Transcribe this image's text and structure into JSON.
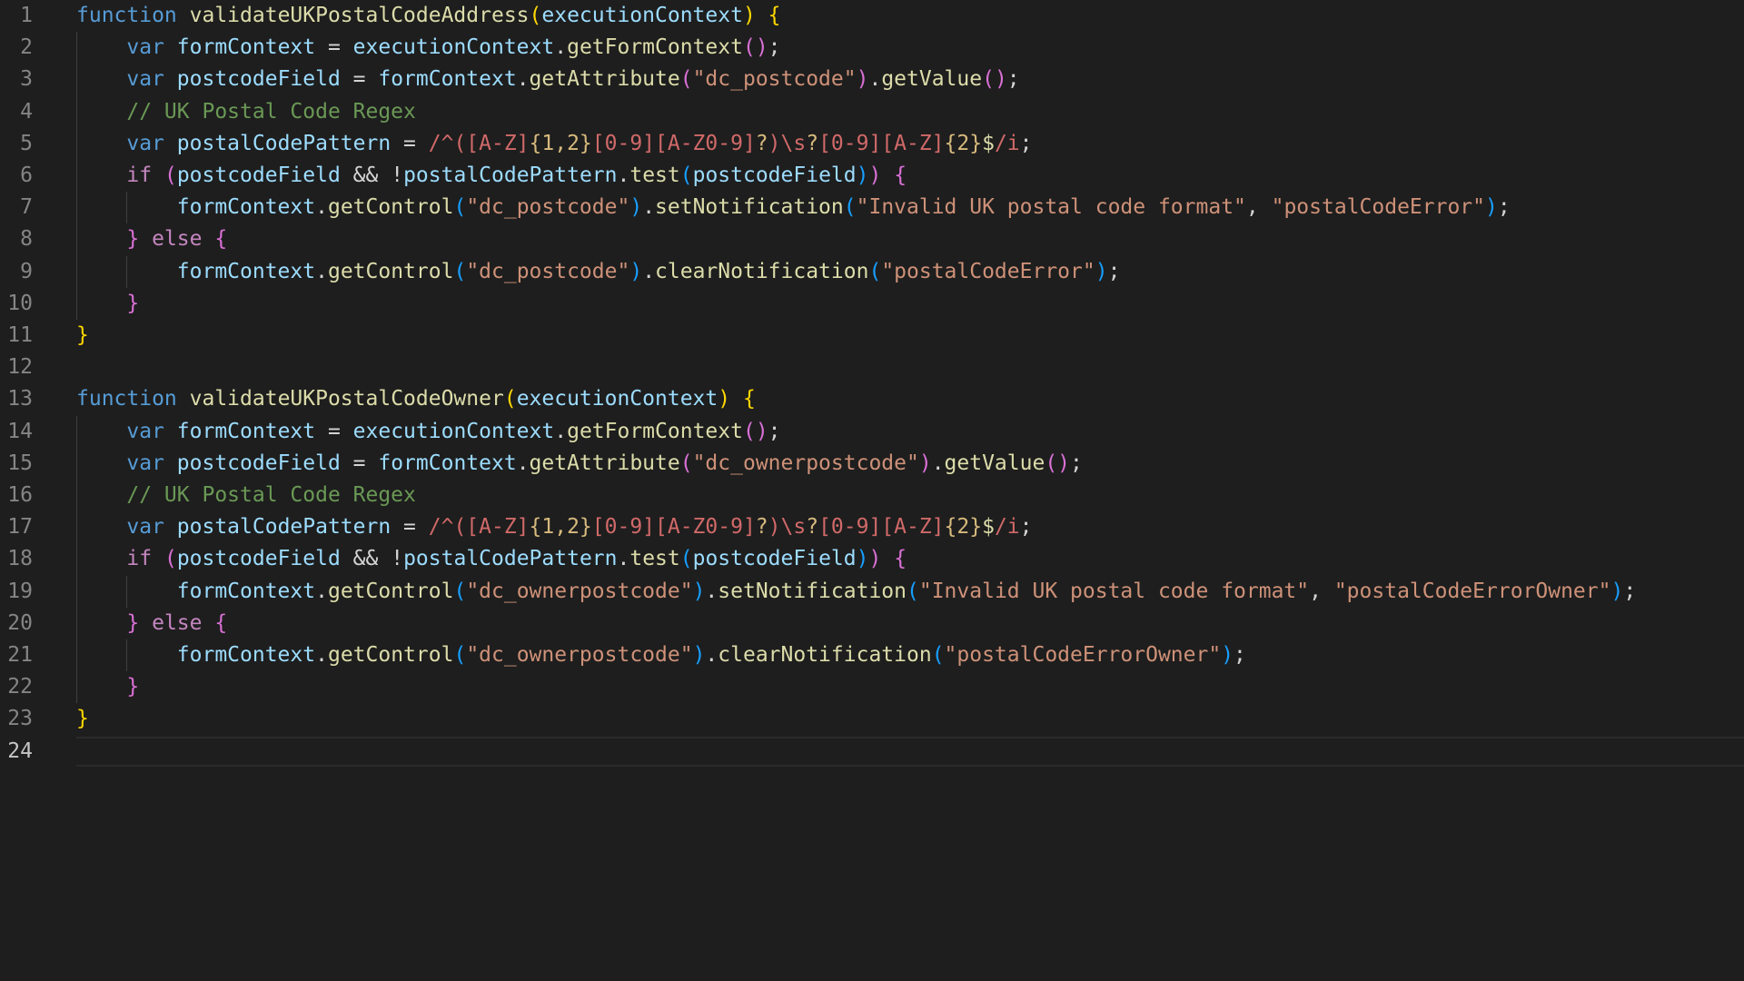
{
  "editor": {
    "language": "javascript",
    "current_line": 24,
    "colors": {
      "background": "#1e1e1e",
      "line_number": "#858585",
      "line_number_active": "#c6c6c6",
      "keyword": "#569cd6",
      "control": "#c586c0",
      "function": "#dcdcaa",
      "variable": "#9cdcfe",
      "string": "#ce9178",
      "comment": "#6a9955",
      "regex": "#d16969",
      "bracket_level_1": "#ffd700",
      "bracket_level_2": "#da70d6",
      "bracket_level_3": "#179fff"
    },
    "lines": [
      {
        "n": "1",
        "tokens": [
          [
            "kw",
            "function"
          ],
          [
            "op",
            " "
          ],
          [
            "fn",
            "validateUKPostalCodeAddress"
          ],
          [
            "b1",
            "("
          ],
          [
            "var",
            "executionContext"
          ],
          [
            "b1",
            ")"
          ],
          [
            "op",
            " "
          ],
          [
            "b1",
            "{"
          ]
        ]
      },
      {
        "n": "2",
        "tokens": [
          [
            "op",
            "    "
          ],
          [
            "kw",
            "var"
          ],
          [
            "op",
            " "
          ],
          [
            "var",
            "formContext"
          ],
          [
            "op",
            " = "
          ],
          [
            "var",
            "executionContext"
          ],
          [
            "op",
            "."
          ],
          [
            "fn",
            "getFormContext"
          ],
          [
            "b2",
            "()"
          ],
          [
            "op",
            ";"
          ]
        ]
      },
      {
        "n": "3",
        "tokens": [
          [
            "op",
            "    "
          ],
          [
            "kw",
            "var"
          ],
          [
            "op",
            " "
          ],
          [
            "var",
            "postcodeField"
          ],
          [
            "op",
            " = "
          ],
          [
            "var",
            "formContext"
          ],
          [
            "op",
            "."
          ],
          [
            "fn",
            "getAttribute"
          ],
          [
            "b2",
            "("
          ],
          [
            "str",
            "\"dc_postcode\""
          ],
          [
            "b2",
            ")"
          ],
          [
            "op",
            "."
          ],
          [
            "fn",
            "getValue"
          ],
          [
            "b2",
            "()"
          ],
          [
            "op",
            ";"
          ]
        ]
      },
      {
        "n": "4",
        "tokens": [
          [
            "op",
            "    "
          ],
          [
            "cmt",
            "// UK Postal Code Regex"
          ]
        ]
      },
      {
        "n": "5",
        "tokens": [
          [
            "op",
            "    "
          ],
          [
            "kw",
            "var"
          ],
          [
            "op",
            " "
          ],
          [
            "var",
            "postalCodePattern"
          ],
          [
            "op",
            " = "
          ],
          [
            "rx",
            "/^([A-Z]"
          ],
          [
            "rxq",
            "{1,2}"
          ],
          [
            "rx",
            "[0-9][A-Z0-9]"
          ],
          [
            "rxq",
            "?"
          ],
          [
            "rx",
            ")\\s"
          ],
          [
            "rxq",
            "?"
          ],
          [
            "rx",
            "[0-9][A-Z]"
          ],
          [
            "rxq",
            "{2}"
          ],
          [
            "rxs",
            "$"
          ],
          [
            "rx",
            "/i"
          ],
          [
            "op",
            ";"
          ]
        ]
      },
      {
        "n": "6",
        "tokens": [
          [
            "op",
            "    "
          ],
          [
            "ctl",
            "if"
          ],
          [
            "op",
            " "
          ],
          [
            "b2",
            "("
          ],
          [
            "var",
            "postcodeField"
          ],
          [
            "op",
            " && !"
          ],
          [
            "var",
            "postalCodePattern"
          ],
          [
            "op",
            "."
          ],
          [
            "fn",
            "test"
          ],
          [
            "b3",
            "("
          ],
          [
            "var",
            "postcodeField"
          ],
          [
            "b3",
            ")"
          ],
          [
            "b2",
            ")"
          ],
          [
            "op",
            " "
          ],
          [
            "b2",
            "{"
          ]
        ]
      },
      {
        "n": "7",
        "tokens": [
          [
            "op",
            "        "
          ],
          [
            "var",
            "formContext"
          ],
          [
            "op",
            "."
          ],
          [
            "fn",
            "getControl"
          ],
          [
            "b3",
            "("
          ],
          [
            "str",
            "\"dc_postcode\""
          ],
          [
            "b3",
            ")"
          ],
          [
            "op",
            "."
          ],
          [
            "fn",
            "setNotification"
          ],
          [
            "b3",
            "("
          ],
          [
            "str",
            "\"Invalid UK postal code format\""
          ],
          [
            "op",
            ", "
          ],
          [
            "str",
            "\"postalCodeError\""
          ],
          [
            "b3",
            ")"
          ],
          [
            "op",
            ";"
          ]
        ]
      },
      {
        "n": "8",
        "tokens": [
          [
            "op",
            "    "
          ],
          [
            "b2",
            "}"
          ],
          [
            "op",
            " "
          ],
          [
            "ctl",
            "else"
          ],
          [
            "op",
            " "
          ],
          [
            "b2",
            "{"
          ]
        ]
      },
      {
        "n": "9",
        "tokens": [
          [
            "op",
            "        "
          ],
          [
            "var",
            "formContext"
          ],
          [
            "op",
            "."
          ],
          [
            "fn",
            "getControl"
          ],
          [
            "b3",
            "("
          ],
          [
            "str",
            "\"dc_postcode\""
          ],
          [
            "b3",
            ")"
          ],
          [
            "op",
            "."
          ],
          [
            "fn",
            "clearNotification"
          ],
          [
            "b3",
            "("
          ],
          [
            "str",
            "\"postalCodeError\""
          ],
          [
            "b3",
            ")"
          ],
          [
            "op",
            ";"
          ]
        ]
      },
      {
        "n": "10",
        "tokens": [
          [
            "op",
            "    "
          ],
          [
            "b2",
            "}"
          ]
        ]
      },
      {
        "n": "11",
        "tokens": [
          [
            "b1",
            "}"
          ]
        ]
      },
      {
        "n": "12",
        "tokens": []
      },
      {
        "n": "13",
        "tokens": [
          [
            "kw",
            "function"
          ],
          [
            "op",
            " "
          ],
          [
            "fn",
            "validateUKPostalCodeOwner"
          ],
          [
            "b1",
            "("
          ],
          [
            "var",
            "executionContext"
          ],
          [
            "b1",
            ")"
          ],
          [
            "op",
            " "
          ],
          [
            "b1",
            "{"
          ]
        ]
      },
      {
        "n": "14",
        "tokens": [
          [
            "op",
            "    "
          ],
          [
            "kw",
            "var"
          ],
          [
            "op",
            " "
          ],
          [
            "var",
            "formContext"
          ],
          [
            "op",
            " = "
          ],
          [
            "var",
            "executionContext"
          ],
          [
            "op",
            "."
          ],
          [
            "fn",
            "getFormContext"
          ],
          [
            "b2",
            "()"
          ],
          [
            "op",
            ";"
          ]
        ]
      },
      {
        "n": "15",
        "tokens": [
          [
            "op",
            "    "
          ],
          [
            "kw",
            "var"
          ],
          [
            "op",
            " "
          ],
          [
            "var",
            "postcodeField"
          ],
          [
            "op",
            " = "
          ],
          [
            "var",
            "formContext"
          ],
          [
            "op",
            "."
          ],
          [
            "fn",
            "getAttribute"
          ],
          [
            "b2",
            "("
          ],
          [
            "str",
            "\"dc_ownerpostcode\""
          ],
          [
            "b2",
            ")"
          ],
          [
            "op",
            "."
          ],
          [
            "fn",
            "getValue"
          ],
          [
            "b2",
            "()"
          ],
          [
            "op",
            ";"
          ]
        ]
      },
      {
        "n": "16",
        "tokens": [
          [
            "op",
            "    "
          ],
          [
            "cmt",
            "// UK Postal Code Regex"
          ]
        ]
      },
      {
        "n": "17",
        "tokens": [
          [
            "op",
            "    "
          ],
          [
            "kw",
            "var"
          ],
          [
            "op",
            " "
          ],
          [
            "var",
            "postalCodePattern"
          ],
          [
            "op",
            " = "
          ],
          [
            "rx",
            "/^([A-Z]"
          ],
          [
            "rxq",
            "{1,2}"
          ],
          [
            "rx",
            "[0-9][A-Z0-9]"
          ],
          [
            "rxq",
            "?"
          ],
          [
            "rx",
            ")\\s"
          ],
          [
            "rxq",
            "?"
          ],
          [
            "rx",
            "[0-9][A-Z]"
          ],
          [
            "rxq",
            "{2}"
          ],
          [
            "rxs",
            "$"
          ],
          [
            "rx",
            "/i"
          ],
          [
            "op",
            ";"
          ]
        ]
      },
      {
        "n": "18",
        "tokens": [
          [
            "op",
            "    "
          ],
          [
            "ctl",
            "if"
          ],
          [
            "op",
            " "
          ],
          [
            "b2",
            "("
          ],
          [
            "var",
            "postcodeField"
          ],
          [
            "op",
            " && !"
          ],
          [
            "var",
            "postalCodePattern"
          ],
          [
            "op",
            "."
          ],
          [
            "fn",
            "test"
          ],
          [
            "b3",
            "("
          ],
          [
            "var",
            "postcodeField"
          ],
          [
            "b3",
            ")"
          ],
          [
            "b2",
            ")"
          ],
          [
            "op",
            " "
          ],
          [
            "b2",
            "{"
          ]
        ]
      },
      {
        "n": "19",
        "tokens": [
          [
            "op",
            "        "
          ],
          [
            "var",
            "formContext"
          ],
          [
            "op",
            "."
          ],
          [
            "fn",
            "getControl"
          ],
          [
            "b3",
            "("
          ],
          [
            "str",
            "\"dc_ownerpostcode\""
          ],
          [
            "b3",
            ")"
          ],
          [
            "op",
            "."
          ],
          [
            "fn",
            "setNotification"
          ],
          [
            "b3",
            "("
          ],
          [
            "str",
            "\"Invalid UK postal code format\""
          ],
          [
            "op",
            ", "
          ],
          [
            "str",
            "\"postalCodeErrorOwner\""
          ],
          [
            "b3",
            ")"
          ],
          [
            "op",
            ";"
          ]
        ]
      },
      {
        "n": "20",
        "tokens": [
          [
            "op",
            "    "
          ],
          [
            "b2",
            "}"
          ],
          [
            "op",
            " "
          ],
          [
            "ctl",
            "else"
          ],
          [
            "op",
            " "
          ],
          [
            "b2",
            "{"
          ]
        ]
      },
      {
        "n": "21",
        "tokens": [
          [
            "op",
            "        "
          ],
          [
            "var",
            "formContext"
          ],
          [
            "op",
            "."
          ],
          [
            "fn",
            "getControl"
          ],
          [
            "b3",
            "("
          ],
          [
            "str",
            "\"dc_ownerpostcode\""
          ],
          [
            "b3",
            ")"
          ],
          [
            "op",
            "."
          ],
          [
            "fn",
            "clearNotification"
          ],
          [
            "b3",
            "("
          ],
          [
            "str",
            "\"postalCodeErrorOwner\""
          ],
          [
            "b3",
            ")"
          ],
          [
            "op",
            ";"
          ]
        ]
      },
      {
        "n": "22",
        "tokens": [
          [
            "op",
            "    "
          ],
          [
            "b2",
            "}"
          ]
        ]
      },
      {
        "n": "23",
        "tokens": [
          [
            "b1",
            "}"
          ]
        ]
      },
      {
        "n": "24",
        "tokens": []
      }
    ]
  }
}
